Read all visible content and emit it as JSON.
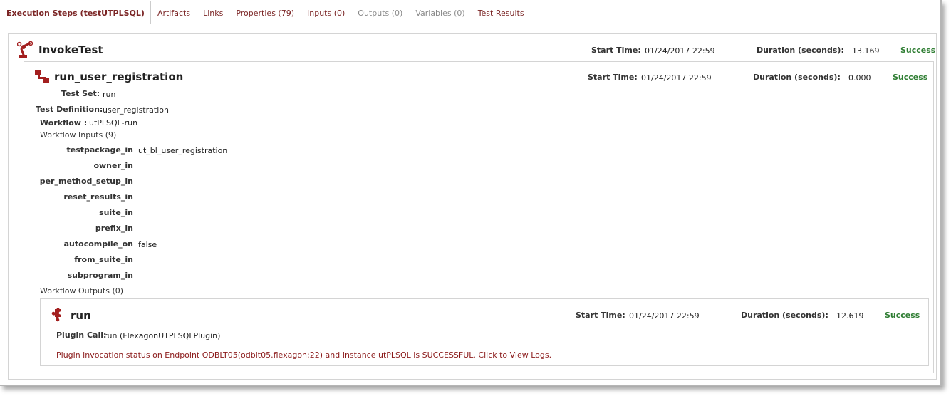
{
  "tabs": [
    {
      "label": "Execution Steps (testUTPLSQL)",
      "active": true,
      "disabled": false
    },
    {
      "label": "Artifacts",
      "active": false,
      "disabled": false
    },
    {
      "label": "Links",
      "active": false,
      "disabled": false
    },
    {
      "label": "Properties (79)",
      "active": false,
      "disabled": false
    },
    {
      "label": "Inputs (0)",
      "active": false,
      "disabled": false
    },
    {
      "label": "Outputs (0)",
      "active": false,
      "disabled": true
    },
    {
      "label": "Variables (0)",
      "active": false,
      "disabled": true
    },
    {
      "label": "Test Results",
      "active": false,
      "disabled": false
    }
  ],
  "invoke": {
    "title": "InvokeTest",
    "start_label": "Start Time:",
    "start_value": "01/24/2017 22:59",
    "duration_label": "Duration (seconds):",
    "duration_value": "13.169",
    "status": "Success",
    "icon": "robot-arm-icon"
  },
  "step": {
    "title": "run_user_registration",
    "start_label": "Start Time:",
    "start_value": "01/24/2017 22:59",
    "duration_label": "Duration (seconds):",
    "duration_value": "0.000",
    "status": "Success",
    "icon": "workflow-icon",
    "test_set_label": "Test Set:",
    "test_set_value": "run",
    "test_def_label": "Test Definition:",
    "test_def_value": "user_registration",
    "workflow_label": "Workflow :",
    "workflow_value": "utPLSQL-run",
    "inputs_heading": "Workflow Inputs (9)",
    "inputs": [
      {
        "name": "testpackage_in",
        "value": "ut_bl_user_registration"
      },
      {
        "name": "owner_in",
        "value": ""
      },
      {
        "name": "per_method_setup_in",
        "value": ""
      },
      {
        "name": "reset_results_in",
        "value": ""
      },
      {
        "name": "suite_in",
        "value": ""
      },
      {
        "name": "prefix_in",
        "value": ""
      },
      {
        "name": "autocompile_on",
        "value": "false"
      },
      {
        "name": "from_suite_in",
        "value": ""
      },
      {
        "name": "subprogram_in",
        "value": ""
      }
    ],
    "outputs_heading": "Workflow Outputs (0)"
  },
  "plugin": {
    "title": "run",
    "start_label": "Start Time:",
    "start_value": "01/24/2017 22:59",
    "duration_label": "Duration (seconds):",
    "duration_value": "12.619",
    "status": "Success",
    "icon": "puzzle-piece-icon",
    "call_label": "Plugin Call:",
    "call_value": "run (FlexagonUTPLSQLPlugin)",
    "log_message": "Plugin invocation status on Endpoint ODBLT05(odblt05.flexagon:22) and Instance utPLSQL is SUCCESSFUL. Click to View Logs."
  },
  "colors": {
    "accent": "#7b2525",
    "success": "#2e7d32",
    "icon": "#a31f1f"
  }
}
